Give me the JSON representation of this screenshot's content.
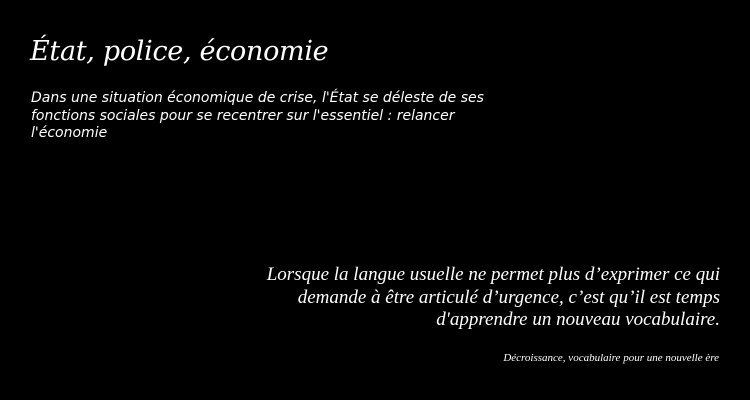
{
  "header": {
    "title": "État, police, économie",
    "subtitle": "Dans une situation économique de crise, l'État se déleste de ses fonctions sociales pour se recentrer sur l'essentiel : relancer l'économie"
  },
  "quote": {
    "lines": [
      "Lorsque la langue usuelle ne permet plus d’exprimer ce qui",
      "demande à être articulé d’urgence, c’est qu’il est temps",
      "d'apprendre un nouveau vocabulaire."
    ],
    "source": "Décroissance, vocabulaire pour une nouvelle ère"
  },
  "colors": {
    "background": "#000000",
    "text": "#ffffff"
  }
}
